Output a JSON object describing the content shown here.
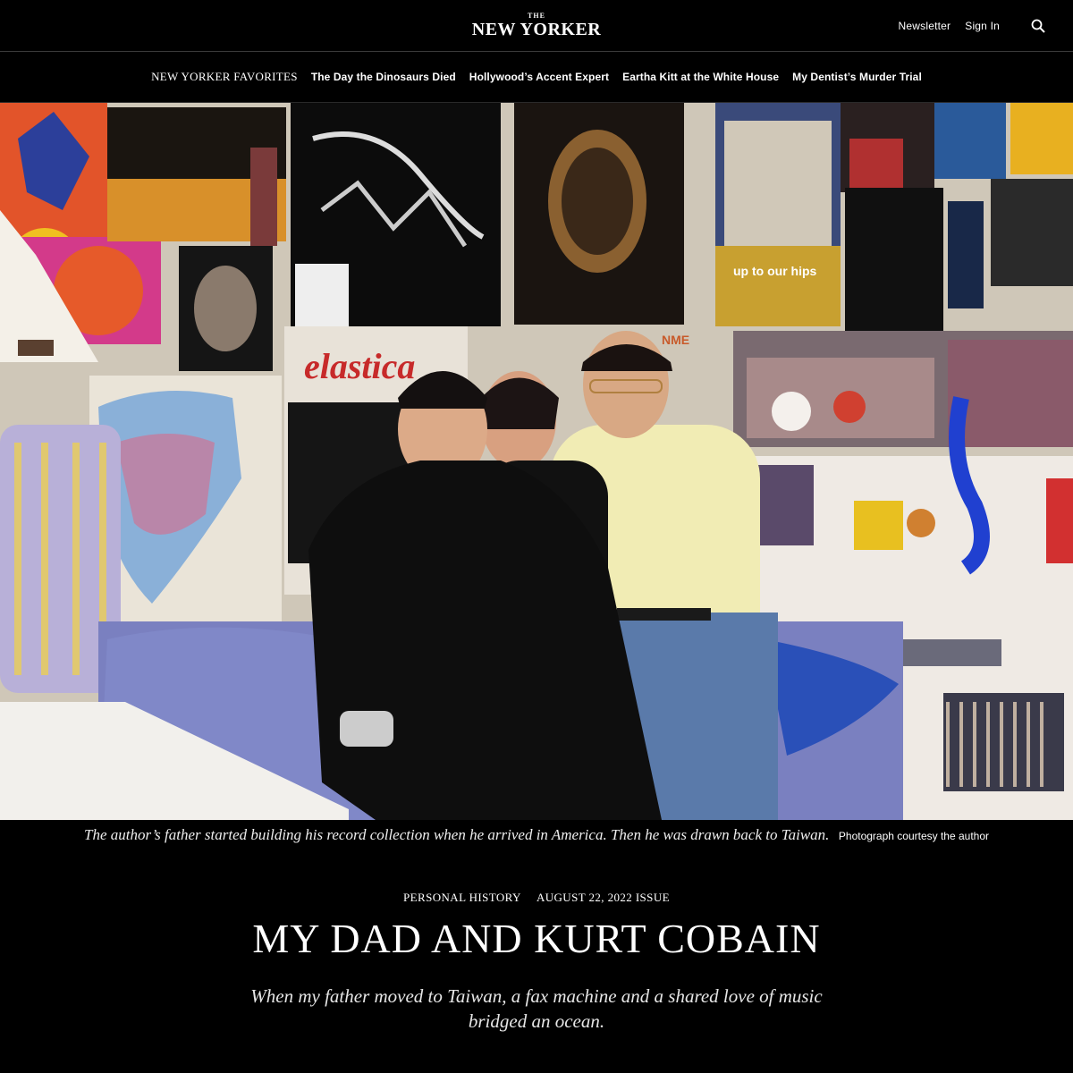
{
  "header": {
    "logo_small": "THE",
    "logo_main": "NEW YORKER",
    "newsletter_label": "Newsletter",
    "signin_label": "Sign In"
  },
  "nav": {
    "title": "NEW YORKER FAVORITES",
    "items": [
      {
        "label": "The Day the Dinosaurs Died"
      },
      {
        "label": "Hollywood’s Accent Expert"
      },
      {
        "label": "Eartha Kitt at the White House"
      },
      {
        "label": "My Dentist’s Murder Trial"
      }
    ]
  },
  "hero": {
    "poster_text_1": "elastica",
    "poster_text_2": "up to our hips",
    "poster_text_3": "NME"
  },
  "caption": {
    "text": "The author’s father started building his record collection when he arrived in America. Then he was drawn back to Taiwan.",
    "credit": "Photograph courtesy the author"
  },
  "article": {
    "rubric": "PERSONAL HISTORY",
    "issue": "AUGUST 22, 2022 ISSUE",
    "headline": "MY DAD AND KURT COBAIN",
    "dek": "When my father moved to Taiwan, a fax machine and a shared love of music bridged an ocean."
  },
  "colors": {
    "background": "#000000",
    "text": "#ffffff"
  }
}
